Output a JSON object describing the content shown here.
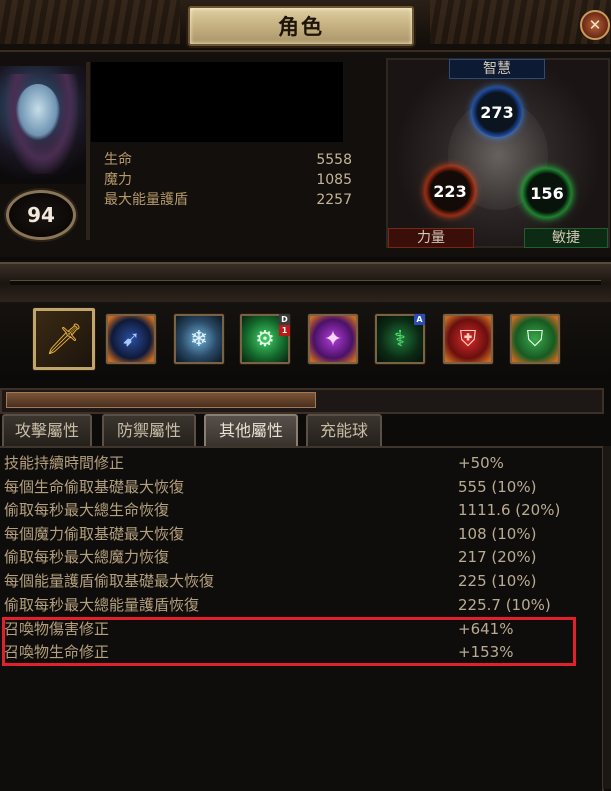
{
  "window": {
    "title": "角色",
    "close_icon": "close-icon"
  },
  "character": {
    "level": "94",
    "stats": [
      {
        "label": "生命",
        "value": "5558"
      },
      {
        "label": "魔力",
        "value": "1085"
      },
      {
        "label": "最大能量護盾",
        "value": "2257"
      }
    ]
  },
  "attributes": {
    "intelligence": {
      "label": "智慧",
      "value": "273",
      "color": "#3a86ff"
    },
    "strength": {
      "label": "力量",
      "value": "223",
      "color": "#ff4b1a"
    },
    "dexterity": {
      "label": "敏捷",
      "value": "156",
      "color": "#2bd84b"
    }
  },
  "skills": [
    {
      "icon": "sword-icon",
      "selected": true
    },
    {
      "icon": "blue-arrow-skill-icon"
    },
    {
      "icon": "ice-golem-skill-icon"
    },
    {
      "icon": "green-gear-skill-icon",
      "tag": "D"
    },
    {
      "icon": "purple-storm-skill-icon"
    },
    {
      "icon": "green-spectre-skill-icon",
      "tag": "A"
    },
    {
      "icon": "red-shield-skill-icon"
    },
    {
      "icon": "green-shield-skill-icon"
    }
  ],
  "tabs": [
    "攻擊屬性",
    "防禦屬性",
    "其他屬性",
    "充能球"
  ],
  "active_tab": "其他屬性",
  "properties": [
    {
      "label": "技能持續時間修正",
      "value": "+50%"
    },
    {
      "label": "每個生命偷取基礎最大恢復",
      "value": "555 (10%)"
    },
    {
      "label": "偷取每秒最大總生命恢復",
      "value": "1111.6 (20%)"
    },
    {
      "label": "每個魔力偷取基礎最大恢復",
      "value": "108 (10%)"
    },
    {
      "label": "偷取每秒最大總魔力恢復",
      "value": "217 (20%)"
    },
    {
      "label": "每個能量護盾偷取基礎最大恢復",
      "value": "225 (10%)"
    },
    {
      "label": "偷取每秒最大總能量護盾恢復",
      "value": "225.7 (10%)"
    },
    {
      "label": "召喚物傷害修正",
      "value": "+641%"
    },
    {
      "label": "召喚物生命修正",
      "value": "+153%"
    }
  ],
  "colors": {
    "highlight_border": "#e0212c",
    "title_plate": "#c7b383"
  }
}
